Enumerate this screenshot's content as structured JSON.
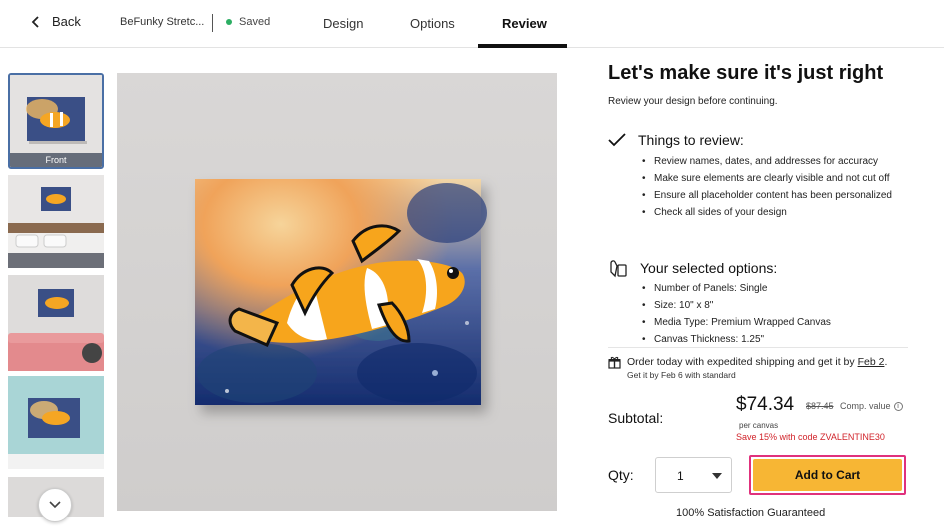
{
  "header": {
    "back_label": "Back",
    "project_name": "BeFunky Stretc...",
    "saved_label": "Saved",
    "tabs": [
      {
        "label": "Design"
      },
      {
        "label": "Options"
      },
      {
        "label": "Review"
      }
    ]
  },
  "thumbnails": {
    "front_label": "Front"
  },
  "review": {
    "title": "Let's make sure it's just right",
    "subtitle": "Review your design before continuing.",
    "things_heading": "Things to review:",
    "things": [
      "Review names, dates, and addresses for accuracy",
      "Make sure elements are clearly visible and not cut off",
      "Ensure all placeholder content has been personalized",
      "Check all sides of your design"
    ],
    "options_heading": "Your selected options:",
    "options": [
      "Number of Panels: Single",
      "Size: 10\" x 8\"",
      "Media Type: Premium Wrapped Canvas",
      "Canvas Thickness: 1.25\""
    ]
  },
  "shipping": {
    "line1_prefix": "Order today with expedited shipping and get it by",
    "line1_date": "Feb 2",
    "line1_suffix": ".",
    "line2": "Get it by Feb 6 with standard"
  },
  "pricing": {
    "subtotal_label": "Subtotal:",
    "price": "$74.34",
    "original_price": "$87.45",
    "comp_label": "Comp. value",
    "per_unit": "per canvas",
    "promo": "Save 15% with code ZVALENTINE30"
  },
  "cart": {
    "qty_label": "Qty:",
    "qty_value": "1",
    "add_to_cart": "Add to Cart",
    "guarantee": "100% Satisfaction Guaranteed"
  },
  "colors": {
    "accent_yellow": "#f7b634",
    "highlight_pink": "#e0317c",
    "promo_red": "#d1232a",
    "saved_green": "#2cae63"
  }
}
